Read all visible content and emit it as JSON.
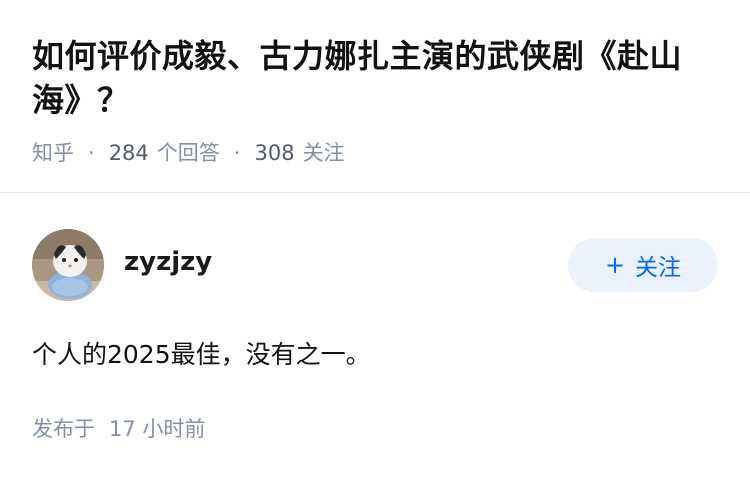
{
  "question": {
    "title": "如何评价成毅、古力娜扎主演的武侠剧《赴山海》？",
    "source": "知乎",
    "answer_count": "284",
    "answer_label": "个回答",
    "follow_count": "308",
    "follow_label": "关注"
  },
  "answer": {
    "author_name": "zyzjzy",
    "follow_button_label": "关注",
    "follow_button_icon": "plus-icon",
    "content": "个人的2025最佳，没有之一。",
    "published_label": "发布于",
    "published_time": "17 小时前"
  },
  "colors": {
    "accent": "#0066ff",
    "follow_button_bg": "#ebf2fb",
    "muted_text": "#8590a6"
  }
}
